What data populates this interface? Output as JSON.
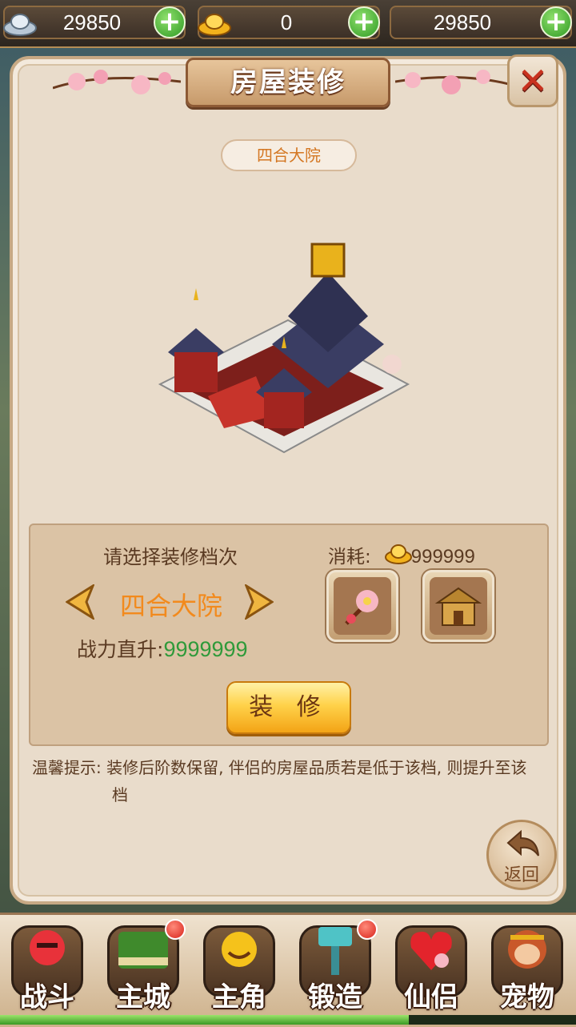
{
  "currency": {
    "silver": "29850",
    "gold_ingot": "0",
    "third": "29850"
  },
  "panel": {
    "title": "房屋装修",
    "close_label": "✕",
    "house_name": "四合大院"
  },
  "selection": {
    "prompt": "请选择装修档次",
    "tier": "四合大院",
    "power_label": "战力直升:",
    "power_value": "9999999",
    "cost_label": "消耗:",
    "cost_value": "999999",
    "items": [
      "peach-blossom-item-icon",
      "house-item-icon"
    ],
    "action_label": "装 修"
  },
  "tip": {
    "line1": "温馨提示: 装修后阶数保留, 伴侣的房屋品质若是低于该档, 则提升至该",
    "line2": "档"
  },
  "back_label": "返回",
  "nav": [
    {
      "label": "战斗",
      "icon": "battle-icon",
      "badge": false
    },
    {
      "label": "主城",
      "icon": "main-city-icon",
      "badge": true
    },
    {
      "label": "主角",
      "icon": "hero-icon",
      "badge": false
    },
    {
      "label": "锻造",
      "icon": "forge-hammer-icon",
      "badge": true
    },
    {
      "label": "仙侣",
      "icon": "partner-heart-icon",
      "badge": false
    },
    {
      "label": "宠物",
      "icon": "pet-monkey-icon",
      "badge": false
    }
  ],
  "progress_fraction": 0.71,
  "colors": {
    "accent_orange": "#f28a1d",
    "power_green": "#2f9a3a",
    "panel_bg": "#e9dccb"
  }
}
